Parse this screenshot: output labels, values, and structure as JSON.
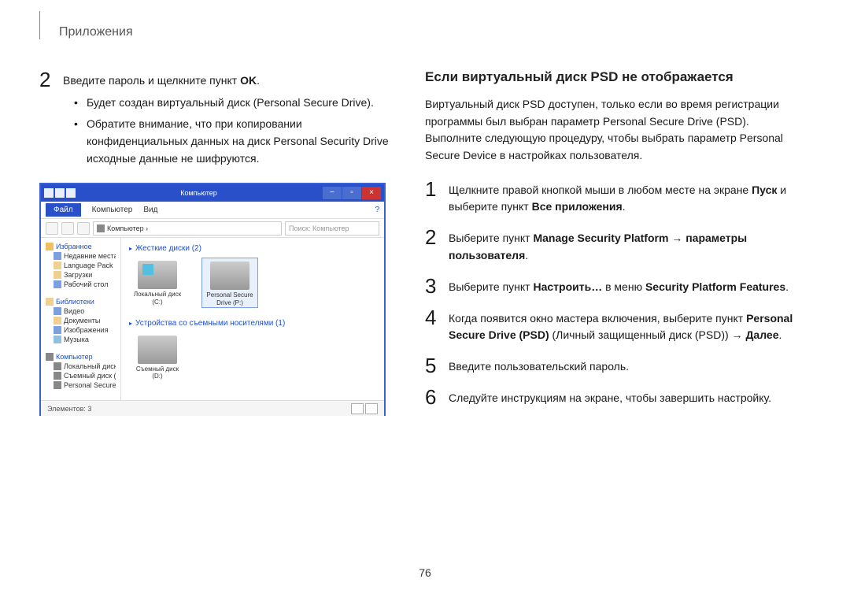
{
  "header": {
    "title": "Приложения"
  },
  "left": {
    "step2": {
      "num": "2",
      "text_a": "Введите пароль и щелкните пункт ",
      "text_b": "OK",
      "text_c": ".",
      "bullet1": "Будет создан виртуальный диск (Personal Secure Drive).",
      "bullet2": "Обратите внимание, что при копировании конфиденциальных данных на диск Personal Security Drive исходные данные не шифруются."
    },
    "screenshot": {
      "title": "Компьютер",
      "ribbon_file": "Файл",
      "ribbon_computer": "Компьютер",
      "ribbon_view": "Вид",
      "path_label": "Компьютер  ›",
      "search_placeholder": "Поиск: Компьютер",
      "sidebar": {
        "favorites_hdr": "Избранное",
        "fav1": "Недавние места",
        "fav2": "Language Pack",
        "fav3": "Загрузки",
        "fav4": "Рабочий стол",
        "libs_hdr": "Библиотеки",
        "lib1": "Видео",
        "lib2": "Документы",
        "lib3": "Изображения",
        "lib4": "Музыка",
        "comp_hdr": "Компьютер",
        "comp1": "Локальный диск (",
        "comp2": "Съемный диск (",
        "comp3": "Personal Secure ("
      },
      "section1_hdr": "Жесткие диски (2)",
      "drive1_name": "Локальный диск",
      "drive1_sub": "(C:)",
      "drive2_name": "Personal Secure",
      "drive2_sub": "Drive (P:)",
      "section2_hdr": "Устройства со съемными носителями (1)",
      "drive3_name": "Съемный диск",
      "drive3_sub": "(D:)",
      "status_text": "Элементов: 3"
    }
  },
  "right": {
    "subheading": "Если виртуальный диск PSD не отображается",
    "intro": "Виртуальный диск PSD доступен, только если во время регистрации программы был выбран параметр Personal Secure Drive (PSD). Выполните следующую процедуру, чтобы выбрать параметр Personal Secure Device в настройках пользователя.",
    "step1": {
      "num": "1",
      "a": "Щелкните правой кнопкой мыши в любом месте на экране ",
      "b": "Пуск",
      "c": " и выберите пункт ",
      "d": "Все приложения",
      "e": "."
    },
    "step2": {
      "num": "2",
      "a": "Выберите пункт ",
      "b": "Manage Security Platform",
      "c": " → ",
      "d": "параметры пользователя",
      "e": "."
    },
    "step3": {
      "num": "3",
      "a": "Выберите пункт ",
      "b": "Настроить…",
      "c": " в меню ",
      "d": "Security Platform Features",
      "e": "."
    },
    "step4": {
      "num": "4",
      "a": "Когда появится окно мастера включения, выберите пункт ",
      "b": "Personal Secure Drive (PSD)",
      "c": " (Личный защищенный диск (PSD)) → ",
      "d": "Далее",
      "e": "."
    },
    "step5": {
      "num": "5",
      "a": "Введите пользовательский пароль."
    },
    "step6": {
      "num": "6",
      "a": "Следуйте инструкциям на экране, чтобы завершить настройку."
    }
  },
  "page_number": "76"
}
